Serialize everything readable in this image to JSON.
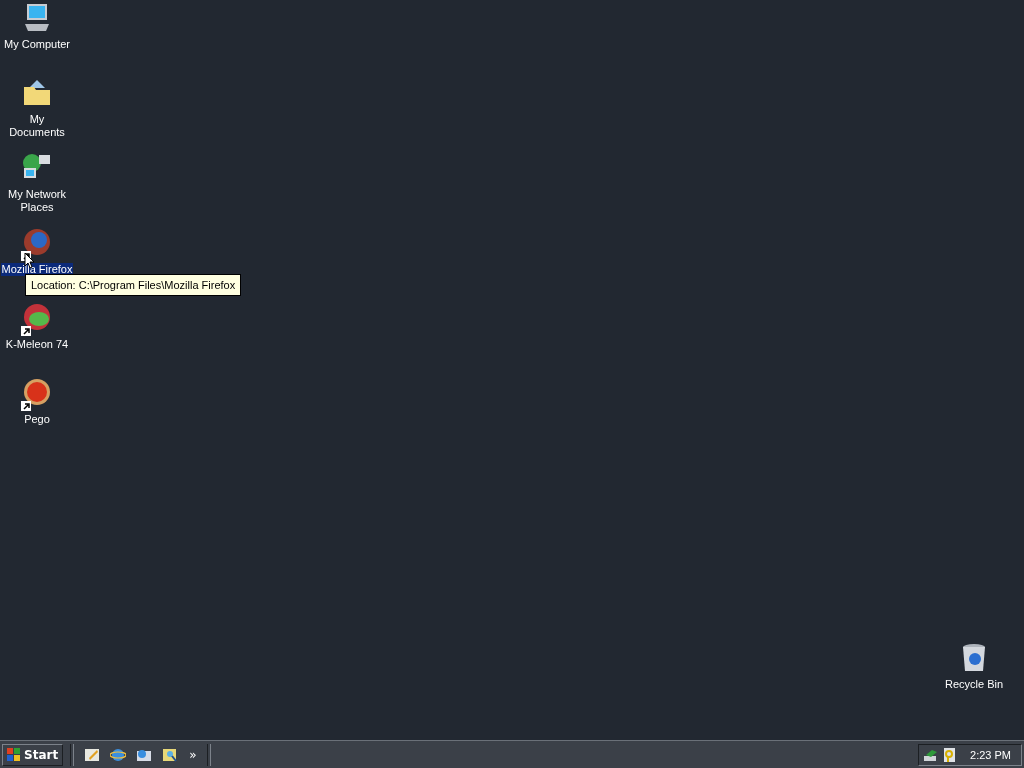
{
  "desktop_icons": [
    {
      "kind": "computer",
      "label": "My Computer",
      "shortcut": false,
      "selected": false
    },
    {
      "kind": "documents",
      "label": "My Documents",
      "shortcut": false,
      "selected": false
    },
    {
      "kind": "network",
      "label": "My Network Places",
      "shortcut": false,
      "selected": false
    },
    {
      "kind": "firefox",
      "label": "Mozilla Firefox",
      "shortcut": true,
      "selected": true
    },
    {
      "kind": "kmeleon",
      "label": "K-Meleon 74",
      "shortcut": true,
      "selected": false
    },
    {
      "kind": "pego",
      "label": "Pego",
      "shortcut": true,
      "selected": false
    }
  ],
  "tooltip": {
    "text": "Location: C:\\Program Files\\Mozilla Firefox"
  },
  "recycle_bin": {
    "kind": "recycle",
    "label": "Recycle Bin",
    "shortcut": false,
    "selected": false
  },
  "taskbar": {
    "start_label": "Start",
    "quick_launch": [
      {
        "kind": "desktop"
      },
      {
        "kind": "ie"
      },
      {
        "kind": "mail"
      },
      {
        "kind": "search"
      }
    ],
    "chevron": "»",
    "tray_icons": [
      {
        "kind": "network"
      },
      {
        "kind": "key"
      }
    ],
    "clock": "2:23 PM"
  }
}
